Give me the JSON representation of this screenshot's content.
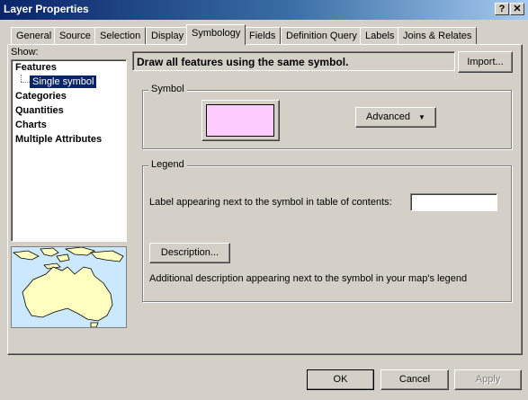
{
  "window": {
    "title": "Layer Properties",
    "help_btn": "?",
    "close_btn": "✕"
  },
  "tabs": [
    {
      "label": "General"
    },
    {
      "label": "Source"
    },
    {
      "label": "Selection"
    },
    {
      "label": "Display"
    },
    {
      "label": "Symbology"
    },
    {
      "label": "Fields"
    },
    {
      "label": "Definition Query"
    },
    {
      "label": "Labels"
    },
    {
      "label": "Joins & Relates"
    }
  ],
  "active_tab": "Symbology",
  "sidebar": {
    "show_label": "Show:",
    "items": [
      {
        "label": "Features"
      },
      {
        "label": "Single symbol"
      },
      {
        "label": "Categories"
      },
      {
        "label": "Quantities"
      },
      {
        "label": "Charts"
      },
      {
        "label": "Multiple Attributes"
      }
    ]
  },
  "main": {
    "header": "Draw all features using the same symbol.",
    "import_label": "Import...",
    "symbol_group": "Symbol",
    "symbol_color": "#ffccff",
    "advanced_label": "Advanced",
    "legend_group": "Legend",
    "legend_label": "Label appearing next to the symbol in table of contents:",
    "legend_value": "",
    "description_label": "Description...",
    "description_text": "Additional description appearing next to the symbol in your map's legend"
  },
  "footer": {
    "ok": "OK",
    "cancel": "Cancel",
    "apply": "Apply"
  },
  "colors": {
    "sea": "#cce8ff",
    "land": "#ffffc0",
    "selection": "#0a246a"
  }
}
